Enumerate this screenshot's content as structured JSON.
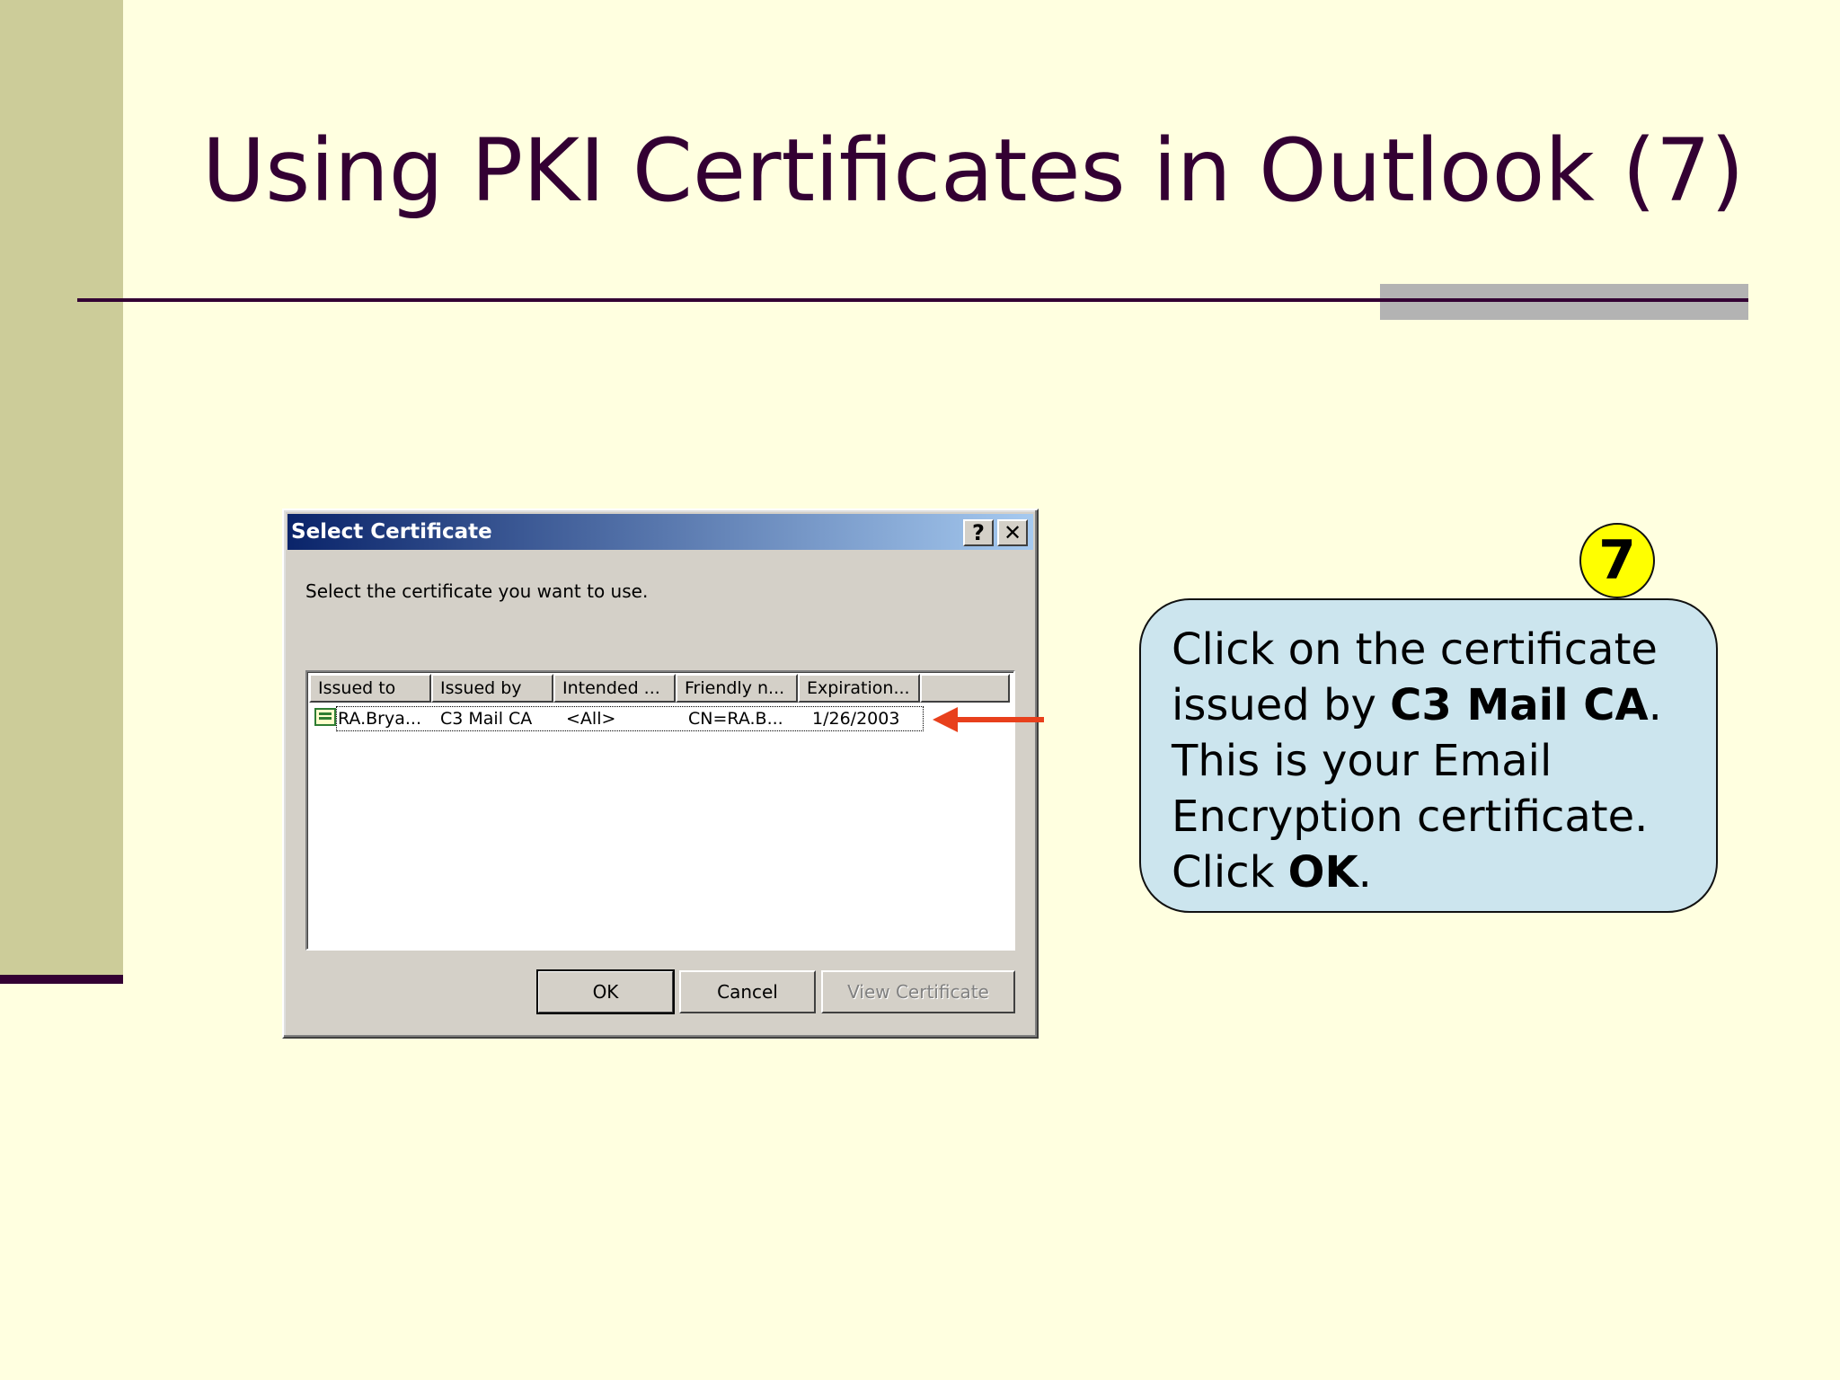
{
  "slide": {
    "title": "Using PKI Certificates in Outlook (7)"
  },
  "dialog": {
    "title": "Select Certificate",
    "help_label": "?",
    "close_label": "✕",
    "instruction": "Select the certificate you want to use.",
    "columns": [
      "Issued to",
      "Issued by",
      "Intended ...",
      "Friendly n...",
      "Expiration..."
    ],
    "rows": [
      {
        "issued_to": "RA.Brya...",
        "issued_by": "C3 Mail CA",
        "intended": "<All>",
        "friendly": "CN=RA.B...",
        "expiration": "1/26/2003"
      }
    ],
    "buttons": {
      "ok": "OK",
      "cancel": "Cancel",
      "view": "View Certificate"
    }
  },
  "callout": {
    "step": "7",
    "line1": "Click on the certificate issued by ",
    "bold1": "C3 Mail CA",
    "line2": ". This is your Email Encryption certificate. Click ",
    "bold2": "OK",
    "line3": "."
  },
  "colors": {
    "background": "#ffffe0",
    "sidebar": "#cccc99",
    "title": "#330033",
    "callout_fill": "#cce5ee",
    "badge_fill": "#ffff00",
    "arrow": "#e8401c"
  },
  "icons": {
    "arrow": "left-arrow-icon",
    "certificate": "certificate-icon"
  }
}
